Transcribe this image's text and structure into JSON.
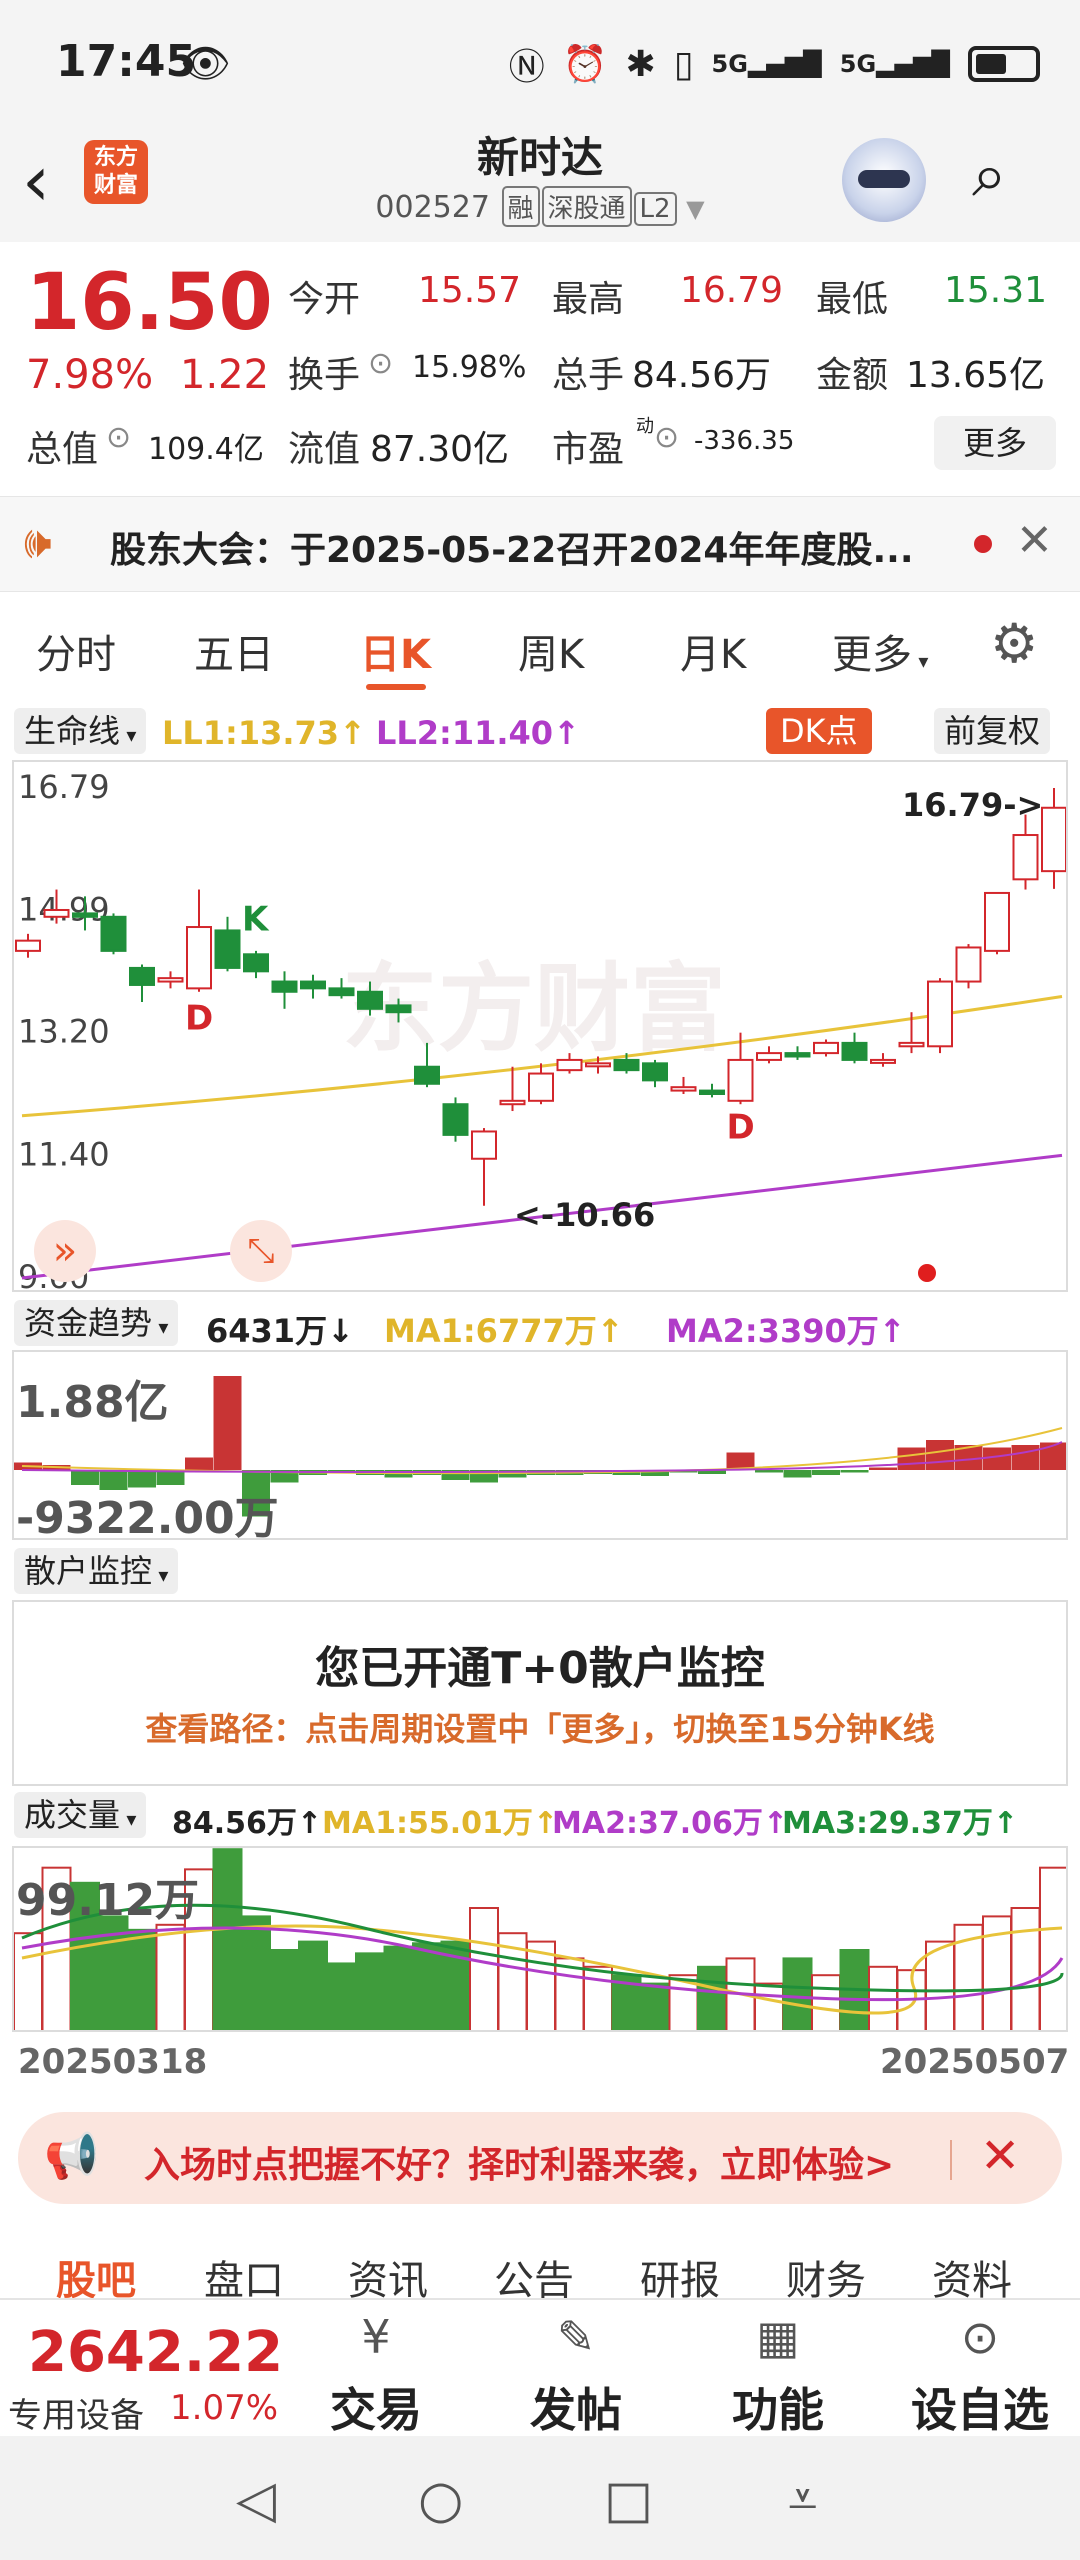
{
  "status": {
    "time": "17:45",
    "signal_a": "5G",
    "signal_b": "5G"
  },
  "header": {
    "logo_line1": "东方",
    "logo_line2": "财富",
    "name": "新时达",
    "code": "002527",
    "tags": [
      "融",
      "深股通",
      "L2"
    ]
  },
  "quote": {
    "price": "16.50",
    "change_pct": "7.98%",
    "change": "1.22",
    "open_label": "今开",
    "open": "15.57",
    "high_label": "最高",
    "high": "16.79",
    "low_label": "最低",
    "low": "15.31",
    "turnover_label": "换手",
    "turnover": "15.98%",
    "volume_label": "总手",
    "volume": "84.56万",
    "amount_label": "金额",
    "amount": "13.65亿",
    "mktcap_label": "总值",
    "mktcap": "109.4亿",
    "float_label": "流值",
    "float": "87.30亿",
    "pe_label": "市盈",
    "pe_sup": "动",
    "pe": "-336.35",
    "more": "更多"
  },
  "notice": {
    "text": "股东大会：于2025-05-22召开2024年年度股..."
  },
  "tabs": [
    "分时",
    "五日",
    "日K",
    "周K",
    "月K",
    "更多"
  ],
  "kline": {
    "indicator": "生命线",
    "ll1": "LL1:13.73↑",
    "ll2": "LL2:11.40↑",
    "dk": "DK点",
    "adjust": "前复权",
    "top_label": "16.79->",
    "bottom_label": "<-10.66",
    "marker_d": "D",
    "marker_k": "K",
    "colors": {
      "up": "#d3262b",
      "down": "#1f8f3a",
      "ll1": "#e8c33a",
      "ll2": "#b03cc8"
    }
  },
  "fund": {
    "name": "资金趋势",
    "value": "6431万↓",
    "ma1": "MA1:6777万↑",
    "ma2": "MA2:3390万↑",
    "max": "1.88亿",
    "min": "-9322.00万"
  },
  "retail": {
    "name": "散户监控",
    "title": "您已开通T+0散户监控",
    "sub": "查看路径：点击周期设置中「更多」，切换至15分钟K线"
  },
  "volume": {
    "name": "成交量",
    "value": "84.56万↑",
    "ma1": "MA1:55.01万↑",
    "ma2": "MA2:37.06万↑",
    "ma3": "MA3:29.37万↑",
    "max": "99.12万",
    "start_date": "20250318",
    "end_date": "20250507"
  },
  "chart_data": {
    "type": "candlestick",
    "y_labels": [
      "16.79",
      "14.99",
      "13.20",
      "11.40",
      "9.60"
    ],
    "ylim": [
      9.6,
      16.79
    ],
    "x": [
      "20250318",
      "20250507"
    ],
    "series": [
      {
        "name": "LL1",
        "values": [
          11.98,
          13.73
        ]
      },
      {
        "name": "LL2",
        "values": [
          9.6,
          11.4
        ]
      }
    ]
  },
  "promo": {
    "text": "入场时点把握不好？择时利器来袭，立即体验>"
  },
  "subtabs": [
    "股吧",
    "盘口",
    "资讯",
    "公告",
    "研报",
    "财务",
    "资料"
  ],
  "index": {
    "value": "2642.22",
    "name": "专用设备",
    "pct": "1.07%"
  },
  "bottom": [
    "交易",
    "发帖",
    "功能",
    "设自选"
  ]
}
